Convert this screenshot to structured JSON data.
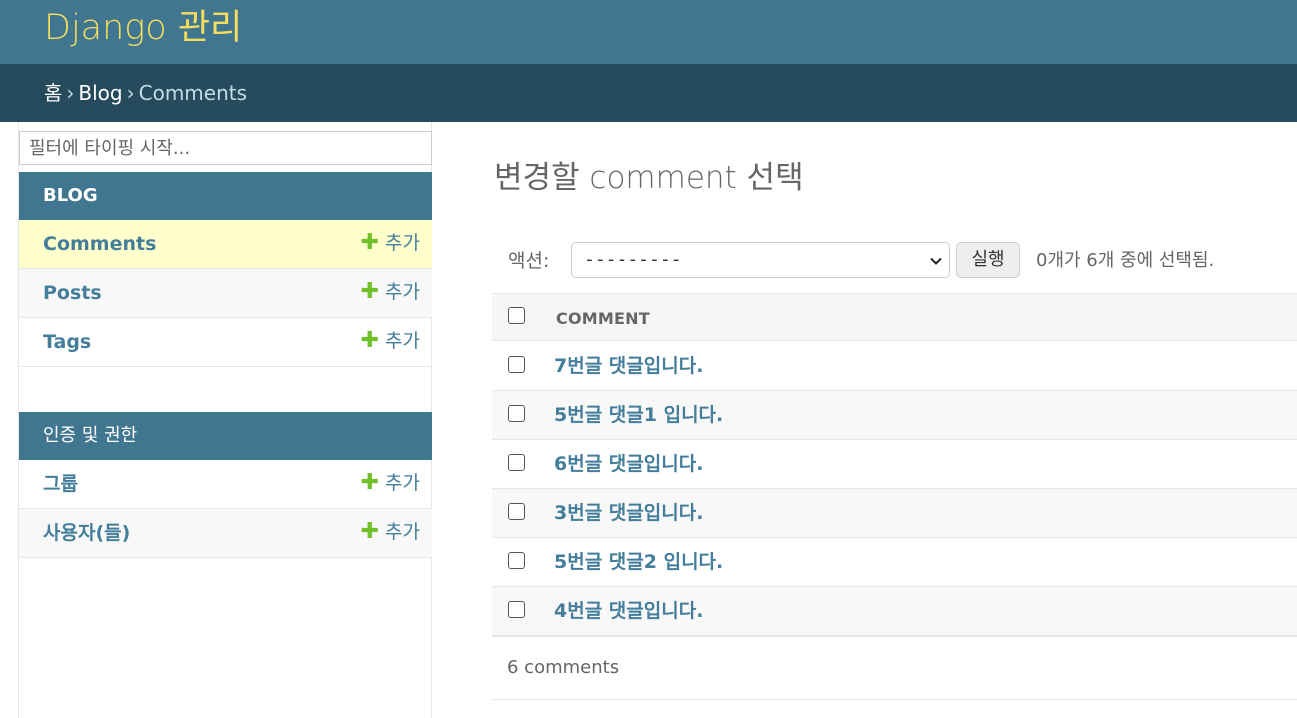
{
  "header": {
    "brand": "Django 관리"
  },
  "breadcrumbs": {
    "home": "홈",
    "app": "Blog",
    "current": "Comments",
    "separator": "›"
  },
  "nav": {
    "filter_placeholder": "필터에 타이핑 시작...",
    "modules": [
      {
        "caption": "BLOG",
        "models": [
          {
            "name": "Comments",
            "add": "추가",
            "current": true
          },
          {
            "name": "Posts",
            "add": "추가"
          },
          {
            "name": "Tags",
            "add": "추가"
          }
        ]
      },
      {
        "caption": "인증 및 권한",
        "models": [
          {
            "name": "그룹",
            "add": "추가"
          },
          {
            "name": "사용자(들)",
            "add": "추가"
          }
        ]
      }
    ]
  },
  "content": {
    "title": "변경할 comment 선택",
    "actions": {
      "label": "액션:",
      "selected": "---------",
      "go_label": "실행",
      "counter": "0개가 6개 중에 선택됨."
    },
    "table": {
      "column": "COMMENT",
      "rows": [
        "7번글 댓글입니다.",
        "5번글 댓글1 입니다.",
        "6번글 댓글입니다.",
        "3번글 댓글입니다.",
        "5번글 댓글2 입니다.",
        "4번글 댓글입니다."
      ]
    },
    "paginator": "6 comments"
  },
  "colors": {
    "header_bg": "#417690",
    "breadcrumb_bg": "#264b5d",
    "brand": "#f5dd5d",
    "link": "#447e9b",
    "add_plus": "#70bf2b",
    "current_row": "#ffffcc"
  },
  "icons": {
    "add": "plus-icon",
    "dropdown": "chevron-down-icon"
  }
}
